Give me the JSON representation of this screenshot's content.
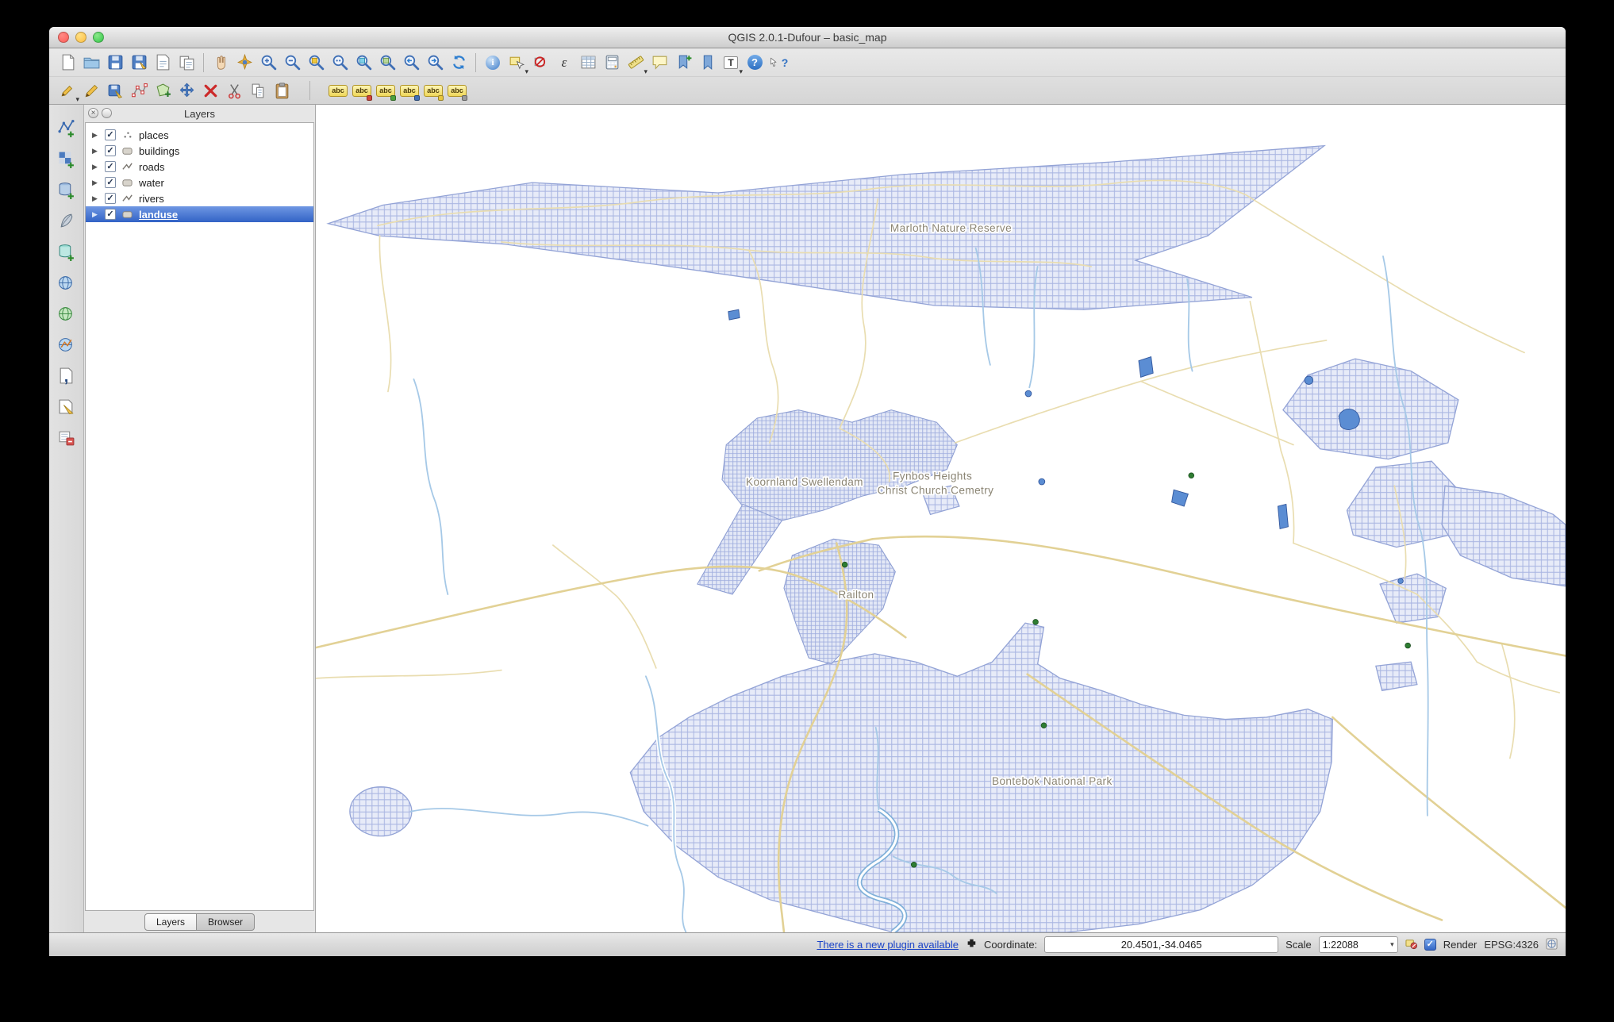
{
  "window": {
    "title": "QGIS 2.0.1-Dufour – basic_map"
  },
  "glyphs": {
    "check": "✓",
    "triangle": "▶",
    "dropdown": "▾",
    "close": "×",
    "expression": "ε",
    "identify": "i",
    "help": "?",
    "whats_this": "?",
    "annotation": "T",
    "abc": "abc",
    "comma": ","
  },
  "layers_panel": {
    "title": "Layers",
    "layers": [
      {
        "label": "places",
        "type": "point",
        "checked": true,
        "selected": false
      },
      {
        "label": "buildings",
        "type": "polygon",
        "checked": true,
        "selected": false
      },
      {
        "label": "roads",
        "type": "line",
        "checked": true,
        "selected": false
      },
      {
        "label": "water",
        "type": "polygon",
        "checked": true,
        "selected": false
      },
      {
        "label": "rivers",
        "type": "line",
        "checked": true,
        "selected": false
      },
      {
        "label": "landuse",
        "type": "polygon",
        "checked": true,
        "selected": true
      }
    ],
    "tabs": [
      {
        "label": "Layers",
        "active": true
      },
      {
        "label": "Browser",
        "active": false
      }
    ]
  },
  "map": {
    "labels": [
      {
        "text": "Marloth Nature Reserve"
      },
      {
        "text": "Koornland Swellendam"
      },
      {
        "text": "Fynbos Heights"
      },
      {
        "text": "Christ Church Cemetry"
      },
      {
        "text": "Railton"
      },
      {
        "text": "Bontebok National Park"
      }
    ],
    "colors": {
      "landuse_fill": "#e7ebf8",
      "landuse_grid": "#aab6e2",
      "road": "#e2d195",
      "river": "#a6c9e7",
      "water": "#5b8dd3"
    }
  },
  "status_bar": {
    "plugin_link": "There is a new plugin available",
    "coordinate_label": "Coordinate:",
    "coordinate_value": "20.4501,-34.0465",
    "scale_label": "Scale",
    "scale_value": "1:22088",
    "render_label": "Render",
    "crs_label": "EPSG:4326"
  }
}
